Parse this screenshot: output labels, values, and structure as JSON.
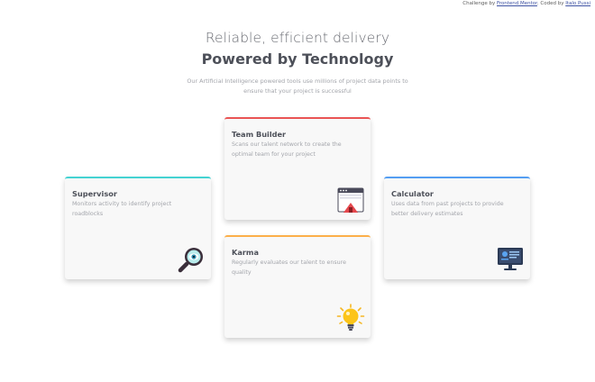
{
  "attribution": {
    "prefix": "Challenge by",
    "mentor_link": "Frontend Mentor",
    "middle": ". Coded by",
    "author_link": "Italo Pussi"
  },
  "header": {
    "subtitle": "Reliable, efficient delivery",
    "title": "Powered by Technology",
    "intro": "Our Artificial Intelligence powered tools use millions of project data points to ensure that your project is successful"
  },
  "cards": {
    "supervisor": {
      "title": "Supervisor",
      "text": "Monitors activity to identify project roadblocks",
      "icon": "magnifier-eye-icon",
      "accent": "#44d3d2"
    },
    "team_builder": {
      "title": "Team Builder",
      "text": "Scans our talent network to create the optimal team for your project",
      "icon": "team-builder-icon",
      "accent": "#ea5454"
    },
    "karma": {
      "title": "Karma",
      "text": "Regularly evaluates our talent to ensure quality",
      "icon": "lightbulb-icon",
      "accent": "#fcaf4a"
    },
    "calculator": {
      "title": "Calculator",
      "text": "Uses data from past projects to provide better delivery estimates",
      "icon": "computer-monitor-icon",
      "accent": "#549ef2"
    }
  }
}
